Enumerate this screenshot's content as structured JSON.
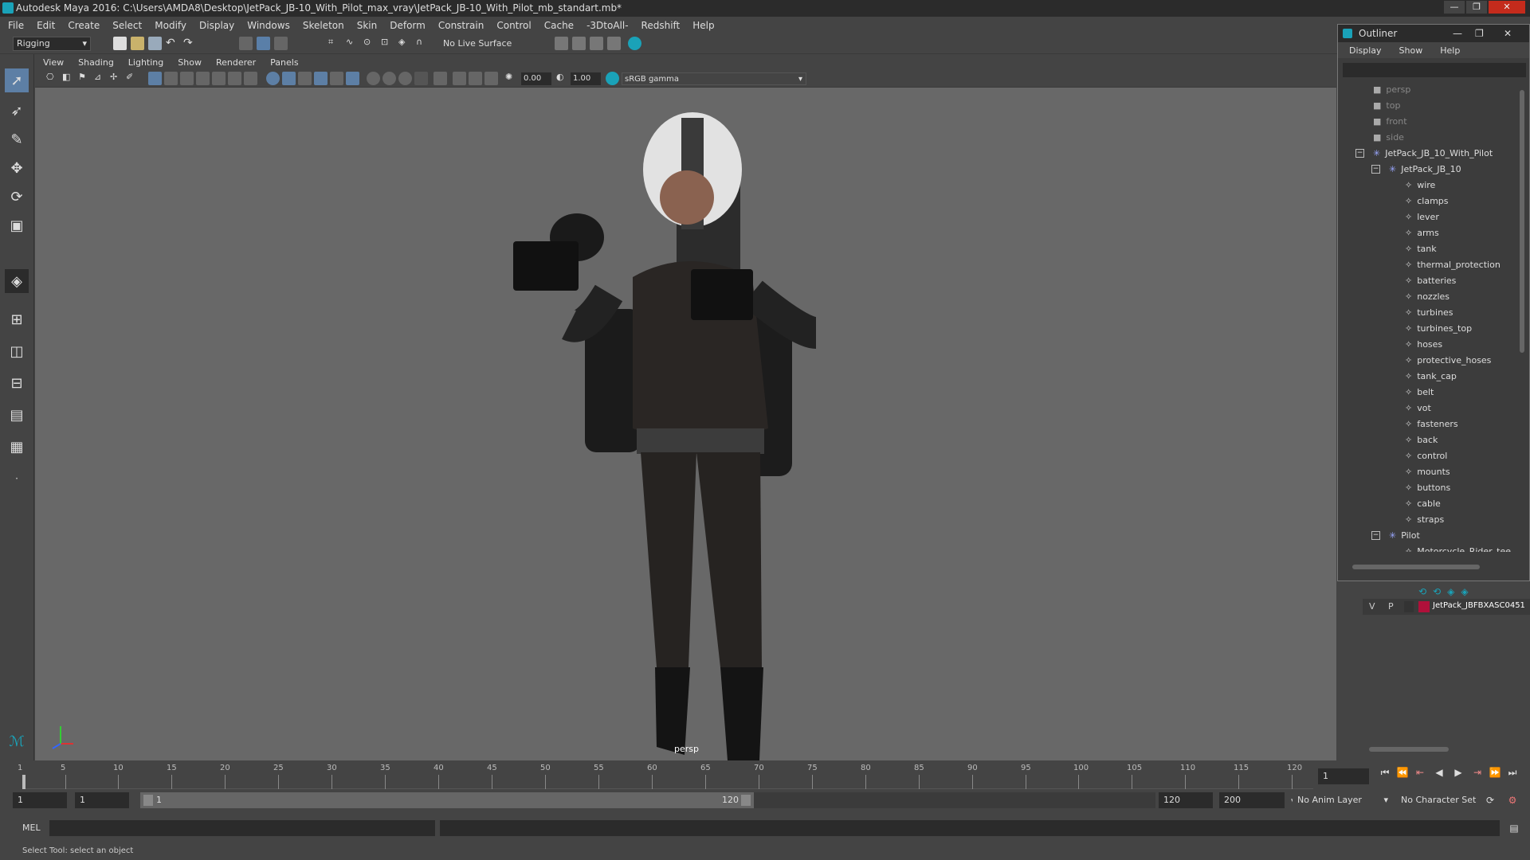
{
  "window": {
    "title": "Autodesk Maya 2016: C:\\Users\\AMDA8\\Desktop\\JetPack_JB-10_With_Pilot_max_vray\\JetPack_JB-10_With_Pilot_mb_standart.mb*"
  },
  "menubar": [
    "File",
    "Edit",
    "Create",
    "Select",
    "Modify",
    "Display",
    "Windows",
    "Skeleton",
    "Skin",
    "Deform",
    "Constrain",
    "Control",
    "Cache",
    "-3DtoAll-",
    "Redshift",
    "Help"
  ],
  "shelf": {
    "mode": "Rigging",
    "live_surface": "No Live Surface"
  },
  "viewport": {
    "menu": [
      "View",
      "Shading",
      "Lighting",
      "Show",
      "Renderer",
      "Panels"
    ],
    "exposure": "0.00",
    "gamma": "1.00",
    "colorspace": "sRGB gamma",
    "camera_label": "persp"
  },
  "outliner": {
    "title": "Outliner",
    "menu": [
      "Display",
      "Show",
      "Help"
    ],
    "cameras": [
      "persp",
      "top",
      "front",
      "side"
    ],
    "root": "JetPack_JB_10_With_Pilot",
    "group1": "JetPack_JB_10",
    "group1_children": [
      "wire",
      "clamps",
      "lever",
      "arms",
      "tank",
      "thermal_protection",
      "batteries",
      "nozzles",
      "turbines",
      "turbines_top",
      "hoses",
      "protective_hoses",
      "tank_cap",
      "belt",
      "vot",
      "fasteners",
      "back",
      "control",
      "mounts",
      "buttons",
      "cable",
      "straps"
    ],
    "group2": "Pilot",
    "group2_children": [
      "Motorcycle_Rider_tee"
    ]
  },
  "layers": {
    "v": "V",
    "p": "P",
    "layer_name": "JetPack_JBFBXASC0451",
    "layer_color": "#b0103a"
  },
  "timeline": {
    "ticks": [
      "1",
      "5",
      "10",
      "15",
      "20",
      "25",
      "30",
      "35",
      "40",
      "45",
      "50",
      "55",
      "60",
      "65",
      "70",
      "75",
      "80",
      "85",
      "90",
      "95",
      "100",
      "105",
      "110",
      "115",
      "120"
    ],
    "current_frame": "1"
  },
  "range": {
    "start": "1",
    "playback_start": "1",
    "slider_start": "1",
    "slider_end": "120",
    "playback_end": "120",
    "end": "200",
    "anim_layer": "No Anim Layer",
    "char_set": "No Character Set"
  },
  "cmdline": {
    "label": "MEL"
  },
  "status": {
    "text": "Select Tool: select an object"
  },
  "colors": {
    "accent": "#1aa2b8",
    "panel": "#444444",
    "viewport_bg": "#686868"
  }
}
